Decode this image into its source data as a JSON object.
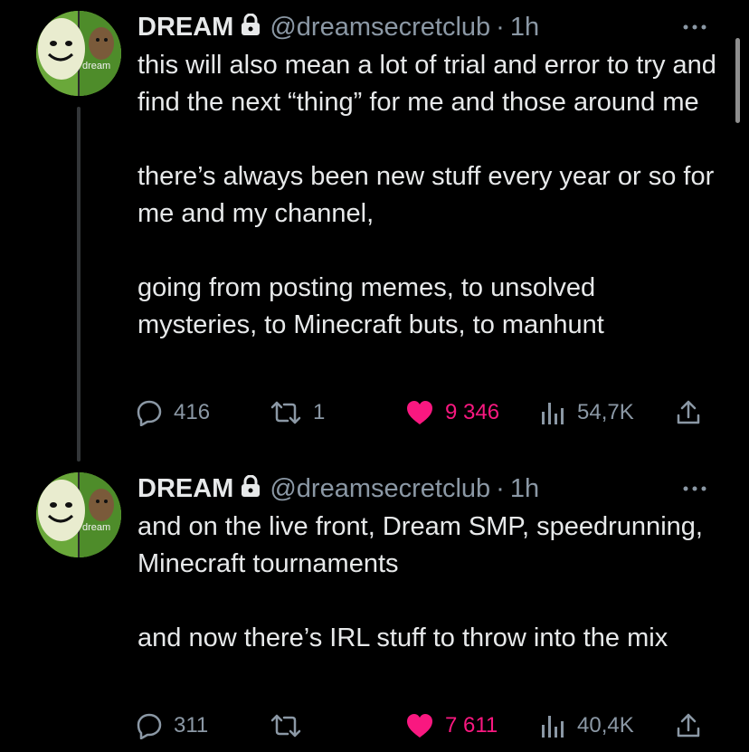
{
  "tweets": [
    {
      "author_name": "DREAM",
      "handle": "@dreamsecretclub",
      "separator": "·",
      "time": "1h",
      "avatar_text": "dream",
      "paragraphs": [
        "this will also mean a lot of trial and error to try and find the next “thing” for me and those around me",
        "there’s always been new stuff every year or so for me and my channel,",
        "going from posting memes, to unsolved mysteries, to Minecraft buts, to manhunt"
      ],
      "replies": "416",
      "retweets": "1",
      "likes": "9 346",
      "views": "54,7K"
    },
    {
      "author_name": "DREAM",
      "handle": "@dreamsecretclub",
      "separator": "·",
      "time": "1h",
      "avatar_text": "dream",
      "paragraphs": [
        "and on the live front, Dream SMP, speedrunning, Minecraft tournaments",
        "and now there’s IRL stuff to throw into the mix"
      ],
      "replies": "311",
      "retweets": "",
      "likes": "7 611",
      "views": "40,4K"
    }
  ],
  "colors": {
    "background": "#000000",
    "text": "#e7e9ea",
    "secondary": "#8b98a5",
    "like": "#f91880"
  },
  "icons": [
    "lock-icon",
    "more-icon",
    "reply-icon",
    "retweet-icon",
    "heart-icon",
    "views-icon",
    "share-icon"
  ]
}
